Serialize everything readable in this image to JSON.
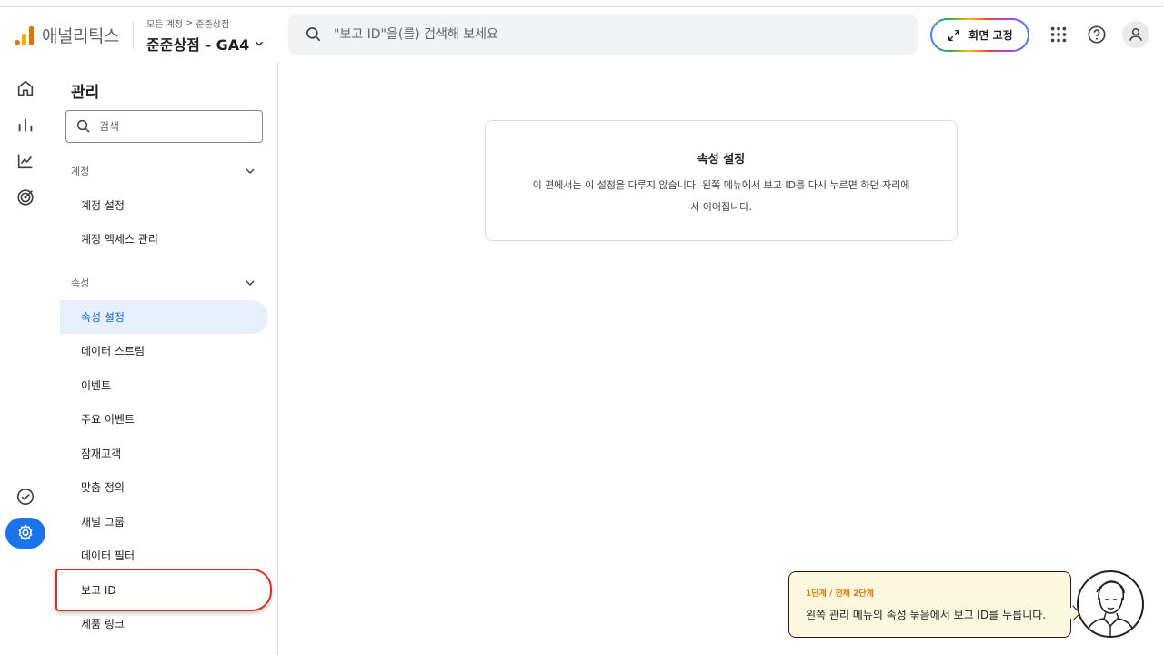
{
  "app": {
    "name": "애널리틱스"
  },
  "breadcrumb": {
    "all_accounts": "모든 계정",
    "separator": ">",
    "account": "준준상점"
  },
  "property": {
    "name": "준준상점 - GA4"
  },
  "search": {
    "placeholder": "\"보고 ID\"을(를) 검색해 보세요"
  },
  "header": {
    "pin_label": "화면 고정"
  },
  "rail": {
    "icons": [
      "home-icon",
      "reports-icon",
      "explore-icon",
      "advertising-icon",
      "checklist-icon",
      "admin-gear-icon"
    ],
    "active": "admin-gear-icon"
  },
  "admin": {
    "title": "관리",
    "search_placeholder": "검색",
    "account_section": {
      "label": "계정",
      "items": [
        {
          "label": "계정 설정"
        },
        {
          "label": "계정 액세스 관리"
        }
      ]
    },
    "property_section": {
      "label": "속성",
      "items": [
        {
          "label": "속성 설정",
          "active": true
        },
        {
          "label": "데이터 스트림"
        },
        {
          "label": "이벤트"
        },
        {
          "label": "주요 이벤트"
        },
        {
          "label": "잠재고객"
        },
        {
          "label": "맞춤 정의"
        },
        {
          "label": "채널 그룹"
        },
        {
          "label": "데이터 필터"
        },
        {
          "label": "보고 ID",
          "highlighted": true
        },
        {
          "label": "제품 링크"
        }
      ]
    }
  },
  "main": {
    "card_title": "속성 설정",
    "card_text": "이 편에서는 이 설정을 다루지 않습니다. 왼쪽 메뉴에서 보고 ID를 다시 누르면 하던 자리에서 이어집니다."
  },
  "tip": {
    "step": "1단계 / 전체 2단계",
    "text": "왼쪽 관리 메뉴의 속성 묶음에서 보고 ID를 누릅니다."
  },
  "colors": {
    "accent": "#1a73e8",
    "active_bg": "#e8f0fe",
    "highlight": "#d93025",
    "tip_bg": "#fef7e0",
    "tip_step": "#e37400"
  }
}
